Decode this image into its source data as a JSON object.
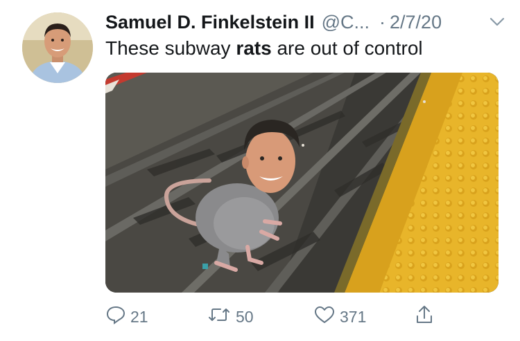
{
  "tweet": {
    "author_name": "Samuel D. Finkelstein II",
    "handle": "@C...",
    "separator": "·",
    "date": "2/7/20",
    "text_before": "These subway ",
    "text_bold": "rats",
    "text_after": " are out of control"
  },
  "actions": {
    "replies": "21",
    "retweets": "50",
    "likes": "371"
  },
  "icons": {
    "menu": "chevron-down-icon",
    "reply": "reply-icon",
    "retweet": "retweet-icon",
    "like": "heart-icon",
    "share": "share-icon"
  },
  "colors": {
    "text": "#14171a",
    "secondary": "#657786",
    "platform_yellow": "#e9b829"
  }
}
